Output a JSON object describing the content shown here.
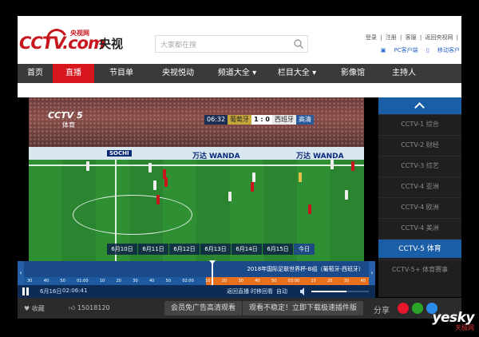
{
  "header": {
    "logo_text": "CCTV.com",
    "logo_small": "央视网",
    "logo_cn": "央视",
    "search_placeholder": "大家都在搜",
    "top_links": [
      "登录",
      "|",
      "注册",
      "|",
      "客服",
      "|",
      "返回央视网",
      "|"
    ],
    "client_links": [
      "PC客户端",
      "移动客户"
    ]
  },
  "nav": {
    "items": [
      {
        "label": "首页",
        "active": false
      },
      {
        "label": "直播",
        "active": true
      },
      {
        "label": "节目单",
        "active": false
      },
      {
        "label": "央视悦动",
        "active": false
      },
      {
        "label": "频道大全",
        "active": false
      },
      {
        "label": "栏目大全",
        "active": false
      },
      {
        "label": "影像馆",
        "active": false
      },
      {
        "label": "主持人",
        "active": false
      }
    ]
  },
  "video": {
    "channel_logo": "CCTV 5",
    "channel_sub": "体育",
    "ads": [
      "SOCHI",
      "万达 WANDA",
      "万达 WANDA"
    ],
    "scoreboard": {
      "time": "06:32",
      "team1": "葡萄牙",
      "score": "1 : 0",
      "team2": "西班牙",
      "tag": "高清"
    },
    "dates": [
      "6月10日",
      "6月11日",
      "6月12日",
      "6月13日",
      "6月14日",
      "6月15日",
      "今日"
    ]
  },
  "timeline": {
    "program_title": "2018年国际足联世界杯-B组（葡萄牙-西班牙）",
    "ticks": [
      "30",
      "40",
      "50",
      "01:00",
      "10",
      "20",
      "30",
      "40",
      "50",
      "02:00",
      "10",
      "20",
      "30",
      "40",
      "50",
      "03:00",
      "10",
      "20",
      "30",
      "40"
    ],
    "left_arrow": "‹",
    "right_arrow": "›"
  },
  "controls": {
    "date": "6月16日",
    "time": "02:06:41",
    "return_live": "返回直播",
    "timeshift": "时移回看",
    "auto": "自动"
  },
  "bottom": {
    "favorite": "收藏",
    "likes": "15018120",
    "ad_free": "会员免广告高清观看",
    "unstable": "观看不稳定！立即下载极速插件版",
    "share": "分享"
  },
  "sidebar": {
    "channels": [
      {
        "label": "CCTV-1 综合",
        "active": false
      },
      {
        "label": "CCTV-2 财经",
        "active": false
      },
      {
        "label": "CCTV-3 综艺",
        "active": false
      },
      {
        "label": "CCTV-4 亚洲",
        "active": false
      },
      {
        "label": "CCTV-4 欧洲",
        "active": false
      },
      {
        "label": "CCTV-4 美洲",
        "active": false
      },
      {
        "label": "CCTV-5 体育",
        "active": true
      },
      {
        "label": "CCTV-5+ 体育赛事",
        "active": false
      }
    ]
  },
  "watermark": {
    "big": "yesky",
    "small": "天极网"
  },
  "colors": {
    "brand_red": "#d7151c",
    "nav_bg": "#3a3a3a",
    "accent_blue": "#1a5ea8",
    "timeline_orange": "#e8701c"
  }
}
